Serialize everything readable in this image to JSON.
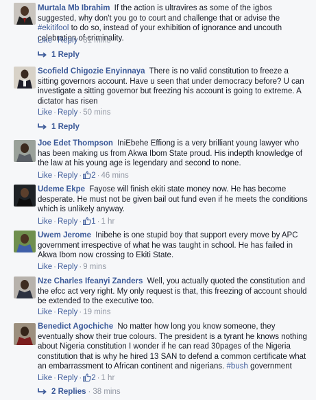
{
  "comments": [
    {
      "name": "Murtala Mb Ibrahim",
      "text_a": "If the action is ultravires as some of the igbos suggested, why don't you go to court and challenge that or advise the ",
      "hashtag": "#ekitifool",
      "text_b": " to do so, instead of your exhibition of ignorance and uncouth celebration of criminality.",
      "like": "Like",
      "reply": "Reply",
      "time": "31 mins",
      "replies_label": "1 Reply"
    },
    {
      "name": "Scofield Chigozie Enyinnaya",
      "text": "There is no valid constitution to freeze a sitting governors account. Have u seen that under democracy before? U can investigate a sitting governor but freezing his account is going to extreme. A dictator has risen",
      "like": "Like",
      "reply": "Reply",
      "time": "50 mins",
      "replies_label": "1 Reply"
    },
    {
      "name": "Joe Edet Thompson",
      "text": "IniEbehe Effiong is a very brilliant young lawyer who has been making us from Akwa Ibom State proud. His indepth knowledge of the law at his young age is legendary and second to none.",
      "like": "Like",
      "reply": "Reply",
      "likes": "2",
      "time": "46 mins"
    },
    {
      "name": "Udeme Ekpe",
      "text": "Fayose will finish ekiti state money now. He has become desperate. He must not be given bail out fund even if he meets the conditions which is unlikely anyway.",
      "like": "Like",
      "reply": "Reply",
      "likes": "1",
      "time": "1 hr"
    },
    {
      "name": "Uwem Jerome",
      "text": "Inibehe is one stupid boy that support every move by APC government irrespective of what he was taught in school. He has failed in Akwa Ibom now crossing to Ekiti State.",
      "like": "Like",
      "reply": "Reply",
      "time": "9 mins"
    },
    {
      "name": "Nze Charles Ifeanyi Zanders",
      "text": "Well, you actually quoted the constitution and the efcc act very right. My only request is that, this freezing of account should be extended to the executive too.",
      "like": "Like",
      "reply": "Reply",
      "time": "19 mins"
    },
    {
      "name": "Benedict Agochiche",
      "text_a": "No matter how long you know someone, they eventually show their true colours. The president is a tyrant he knows nothing about Nigeria constitution I wonder if he can read 30pages of the Nigeria constitution that is why he hired 13 SAN to defend a common certificate what an embarrassment to African continent and nigerians. ",
      "hashtag": "#bush",
      "text_b": " government",
      "like": "Like",
      "reply": "Reply",
      "likes": "2",
      "time": "1 hr",
      "replies_label": "2 Replies",
      "replies_time": "38 mins"
    }
  ],
  "icons": {
    "reply_arrow": "reply-arrow-icon",
    "like_thumb": "like-thumb-icon"
  },
  "colors": {
    "link": "#3b5998",
    "meta": "#9197a3",
    "text": "#141823",
    "background": "#f6f7f9"
  }
}
